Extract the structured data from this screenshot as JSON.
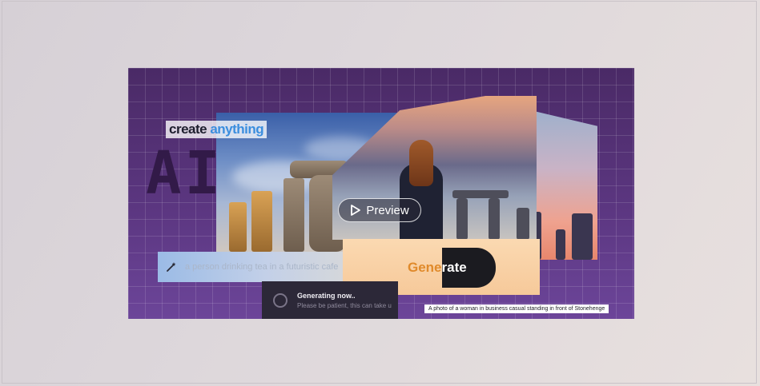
{
  "hero": {
    "headline_word1": "create",
    "headline_word2": "anything",
    "ai_label": "AI",
    "preview_label": "Preview"
  },
  "prompt": {
    "placeholder": "a person drinking tea in a futuristic cafe"
  },
  "generate": {
    "label_part1": "Gene",
    "label_part2": "rate"
  },
  "toast": {
    "title": "Generating now..",
    "subtitle": "Please be patient, this can take u"
  },
  "caption": {
    "text": "A photo of a woman in business casual standing in front of Stonehenge"
  },
  "colors": {
    "card_bg": "#5b3680",
    "headline_accent": "#3b8ede",
    "generate_accent": "#e08a2b",
    "toast_bg": "#2c2838"
  },
  "icons": {
    "preview": "play-icon",
    "prompt": "magic-wand-icon",
    "toast": "spinner-icon"
  }
}
